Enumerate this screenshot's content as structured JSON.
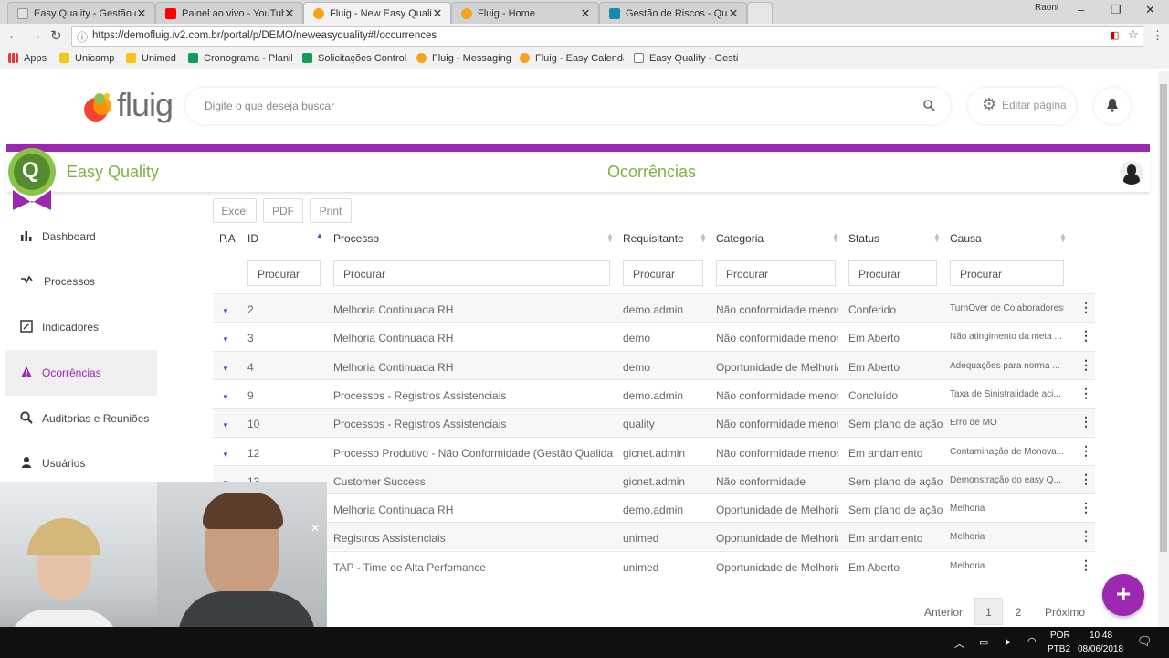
{
  "browser": {
    "tabs": [
      {
        "title": "Easy Quality - Gestão de",
        "color": "#e0e0e0"
      },
      {
        "title": "Painel ao vivo - YouTube",
        "color": "#ff0000"
      },
      {
        "title": "Fluig - New Easy Quality",
        "color": "#f7a21b"
      },
      {
        "title": "Fluig - Home",
        "color": "#f7a21b"
      },
      {
        "title": "Gestão de Riscos - Qualit",
        "color": "#1b8ab0"
      }
    ],
    "user": "Raoni",
    "url": "https://demofluig.iv2.com.br/portal/p/DEMO/neweasyquality#!/occurrences",
    "bookmarks": [
      "Apps",
      "Unicamp",
      "Unimed",
      "Cronograma - Planil",
      "Solicitações Controle",
      "Fluig - Messaging",
      "Fluig - Easy Calenda",
      "Easy Quality - Gestã"
    ]
  },
  "header": {
    "logo": "fluig",
    "search_placeholder": "Digite o que deseja buscar",
    "edit_label": "Editar página"
  },
  "app": {
    "badge": "Q",
    "name": "Easy Quality",
    "page_title": "Ocorrências",
    "accent": "#9c27b0",
    "green": "#7cb342"
  },
  "sidebar": {
    "items": [
      {
        "label": "Dashboard",
        "icon": "bar-chart-icon"
      },
      {
        "label": "Processos",
        "icon": "process-icon"
      },
      {
        "label": "Indicadores",
        "icon": "indicator-icon"
      },
      {
        "label": "Ocorrências",
        "icon": "warning-icon"
      },
      {
        "label": "Auditorias e Reuniões",
        "icon": "search-icon"
      },
      {
        "label": "Usuários",
        "icon": "user-icon"
      }
    ]
  },
  "toolbar": {
    "excel": "Excel",
    "pdf": "PDF",
    "print": "Print"
  },
  "table": {
    "headers": [
      "P.A",
      "ID",
      "Processo",
      "Requisitante",
      "Categoria",
      "Status",
      "Causa"
    ],
    "filter_placeholder": "Procurar",
    "rows": [
      {
        "id": "2",
        "processo": "Melhoria Continuada RH",
        "req": "demo.admin",
        "cat": "Não conformidade menor",
        "status": "Conferido",
        "causa": "TurnOver de Colaboradoress"
      },
      {
        "id": "3",
        "processo": "Melhoria Continuada RH",
        "req": "demo",
        "cat": "Não conformidade menor",
        "status": "Em Aberto",
        "causa": "Não atingimento da meta ..."
      },
      {
        "id": "4",
        "processo": "Melhoria Continuada RH",
        "req": "demo",
        "cat": "Oportunidade de Melhoria",
        "status": "Em Aberto",
        "causa": "Adequações para norma ..."
      },
      {
        "id": "9",
        "processo": "Processos - Registros Assistenciais",
        "req": "demo.admin",
        "cat": "Não conformidade menor",
        "status": "Concluído",
        "causa": "Taxa de Sinistralidade aci..."
      },
      {
        "id": "10",
        "processo": "Processos - Registros Assistenciais",
        "req": "quality",
        "cat": "Não conformidade menor",
        "status": "Sem plano de ação",
        "causa": "Erro de MO"
      },
      {
        "id": "12",
        "processo": "Processo Produtivo - Não Conformidade (Gestão Qualidade)",
        "req": "gicnet.admin",
        "cat": "Não conformidade menor",
        "status": "Em andamento",
        "causa": "Contaminação de Monova..."
      },
      {
        "id": "13",
        "processo": "Customer Success",
        "req": "gicnet.admin",
        "cat": "Não conformidade",
        "status": "Sem plano de ação",
        "causa": "Demonstração do easy Q..."
      },
      {
        "id": "",
        "processo": "Melhoria Continuada RH",
        "req": "demo.admin",
        "cat": "Oportunidade de Melhoria",
        "status": "Sem plano de ação",
        "causa": "Melhoria"
      },
      {
        "id": "",
        "processo": "Registros Assistenciais",
        "req": "unimed",
        "cat": "Oportunidade de Melhoria",
        "status": "Em andamento",
        "causa": "Melhoria"
      },
      {
        "id": "",
        "processo": "TAP - Time de Alta Perfomance",
        "req": "unimed",
        "cat": "Oportunidade de Melhoria",
        "status": "Em Aberto",
        "causa": "Melhoria"
      }
    ]
  },
  "pager": {
    "prev": "Anterior",
    "pages": [
      "1",
      "2"
    ],
    "next": "Próximo"
  },
  "fab": "+",
  "taskbar": {
    "lang1": "POR",
    "lang2": "PTB2",
    "time": "10:48",
    "date": "08/06/2018"
  }
}
